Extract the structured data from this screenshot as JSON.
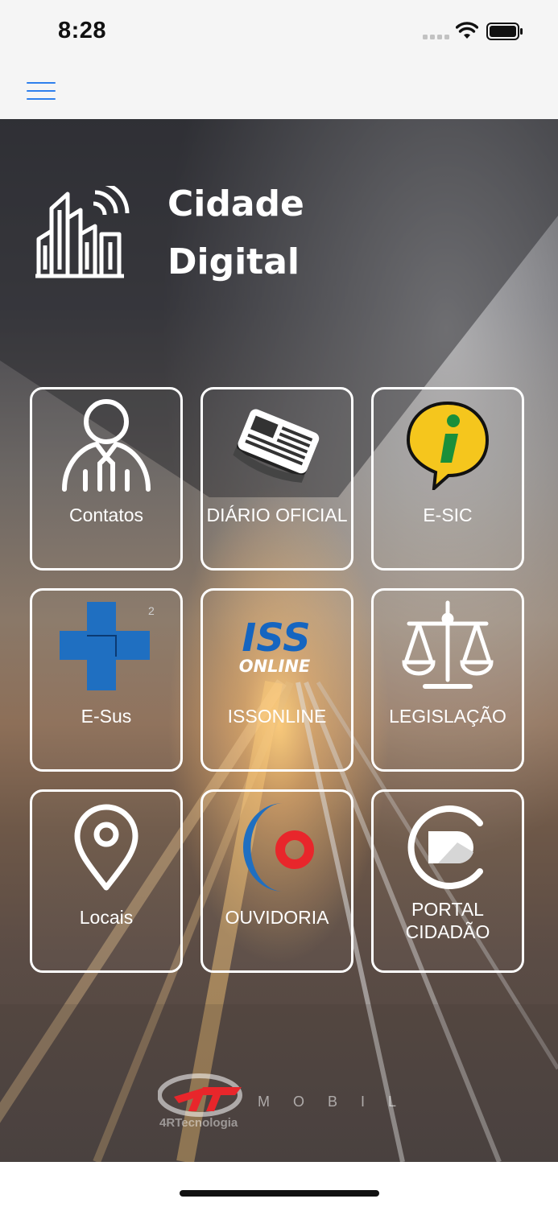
{
  "status_bar": {
    "time": "8:28"
  },
  "nav": {
    "menu_icon": "hamburger-menu-icon"
  },
  "brand": {
    "line1": "Cidade",
    "line2": "Digital",
    "icon": "smart-city-icon"
  },
  "tiles": [
    {
      "label": "Contatos",
      "icon": "person-contact-icon"
    },
    {
      "label": "DIÁRIO OFICIAL",
      "icon": "newspaper-icon"
    },
    {
      "label": "E-SIC",
      "icon": "info-speech-bubble-icon"
    },
    {
      "label": "E-Sus",
      "icon": "health-cross-icon"
    },
    {
      "label": "ISSONLINE",
      "icon": "iss-online-logo-icon"
    },
    {
      "label": "LEGISLAÇÃO",
      "icon": "scales-of-justice-icon"
    },
    {
      "label": "Locais",
      "icon": "map-pin-icon"
    },
    {
      "label": "OUVIDORIA",
      "icon": "ouvidoria-logo-icon"
    },
    {
      "label_line1": "PORTAL",
      "label_line2": "CIDADÃO",
      "icon": "portal-cidadao-logo-icon"
    }
  ],
  "logos": {
    "iss_text": "ISS",
    "online_text": "ONLINE",
    "sus_number": "2"
  },
  "footer": {
    "brand_name": "4RTecnologia",
    "mobile_text": "M O B I L E"
  },
  "colors": {
    "accent": "#2f80ed",
    "esic_yellow": "#f5c61d",
    "esus_blue": "#1f6fc1",
    "ouvidoria_red": "#e8262b",
    "footer_red": "#e8262b"
  }
}
